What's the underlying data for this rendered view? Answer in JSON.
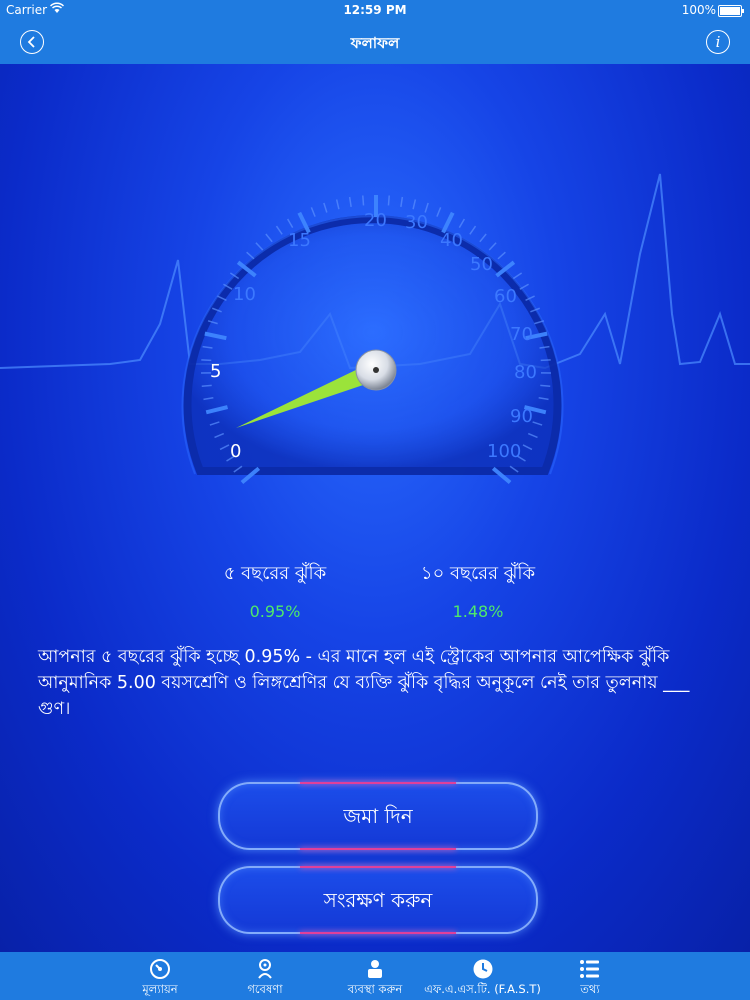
{
  "status": {
    "carrier": "Carrier",
    "time": "12:59 PM",
    "battery": "100%"
  },
  "nav": {
    "title": "ফলাফল"
  },
  "gauge": {
    "value": 5,
    "ticks": [
      "0",
      "5",
      "10",
      "15",
      "20",
      "30",
      "40",
      "50",
      "60",
      "70",
      "80",
      "90",
      "100"
    ]
  },
  "risk": {
    "five_label": "৫ বছরের ঝুঁকি",
    "five_value": "0.95%",
    "ten_label": "১০ বছরের ঝুঁকি",
    "ten_value": "1.48%"
  },
  "explanation": "আপনার ৫ বছরের ঝুঁকি হচ্ছে  0.95% - এর মানে হল এই স্ট্রোকের আপনার আপেক্ষিক ঝুঁকি আনুমানিক 5.00 বয়সশ্রেণি ও লিঙ্গশ্রেণির যে ব্যক্তি ঝুঁকি বৃদ্ধির অনুকূলে নেই তার তুলনায় ___ গুণ।",
  "buttons": {
    "submit": "জমা দিন",
    "save": "সংরক্ষণ করুন"
  },
  "tabs": [
    {
      "label": "মূল্যায়ন",
      "icon": "gauge-icon"
    },
    {
      "label": "গবেষণা",
      "icon": "research-icon"
    },
    {
      "label": "ব্যবস্থা করুন",
      "icon": "manage-icon"
    },
    {
      "label": "এফ.এ.এস.টি. (F.A.S.T)",
      "icon": "clock-icon"
    },
    {
      "label": "তথ্য",
      "icon": "list-icon"
    }
  ],
  "colors": {
    "bar": "#1f7be0",
    "needle": "#9be33a",
    "value": "#4fe86a",
    "button_glow": "#e0409a"
  }
}
